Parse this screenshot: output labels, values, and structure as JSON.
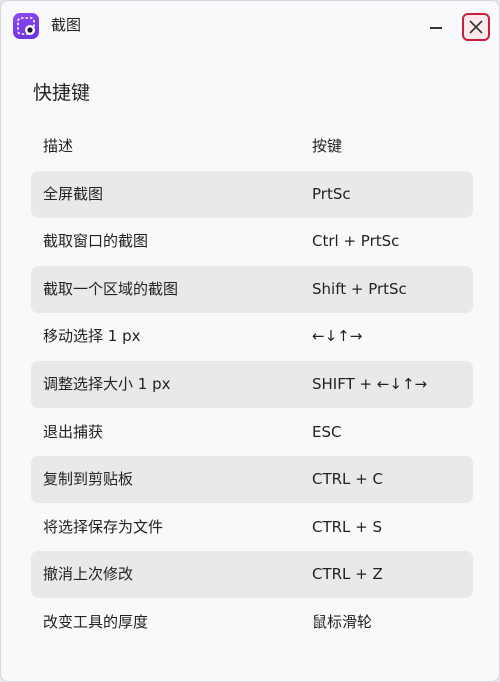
{
  "window": {
    "title": "截图",
    "icon": "screenshot-app-icon",
    "accent": "#7a3cf0",
    "close_color": "#c8203c"
  },
  "main": {
    "heading": "快捷键",
    "header": {
      "description": "描述",
      "key": "按键"
    },
    "rows": [
      {
        "description": "全屏截图",
        "key": "PrtSc"
      },
      {
        "description": "截取窗口的截图",
        "key": "Ctrl + PrtSc"
      },
      {
        "description": "截取一个区域的截图",
        "key": "Shift + PrtSc"
      },
      {
        "description": "移动选择 1 px",
        "key": "←↓↑→"
      },
      {
        "description": "调整选择大小 1 px",
        "key": "SHIFT + ←↓↑→"
      },
      {
        "description": "退出捕获",
        "key": "ESC"
      },
      {
        "description": "复制到剪贴板",
        "key": "CTRL + C"
      },
      {
        "description": "将选择保存为文件",
        "key": "CTRL + S"
      },
      {
        "description": "撤消上次修改",
        "key": "CTRL + Z"
      },
      {
        "description": "改变工具的厚度",
        "key": "鼠标滑轮"
      }
    ]
  }
}
